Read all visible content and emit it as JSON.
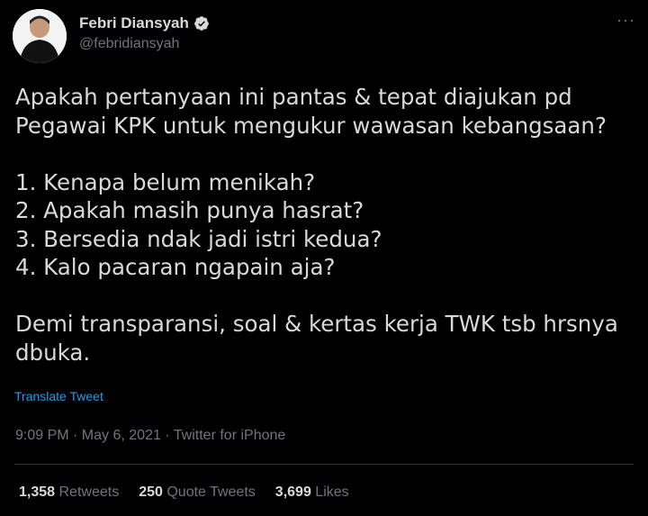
{
  "author": {
    "name": "Febri Diansyah",
    "handle": "@febridiansyah",
    "avatar_icon": "avatar-icon",
    "verified_icon": "verified-badge-icon",
    "verified_color": "#d9d9d9"
  },
  "more_label": "···",
  "tweet": {
    "text": "Apakah pertanyaan ini pantas & tepat diajukan pd\nPegawai KPK untuk mengukur wawasan kebangsaan?\n\n1. Kenapa belum menikah?\n2. Apakah masih punya hasrat?\n3. Bersedia ndak jadi istri kedua?\n4. Kalo pacaran ngapain aja?\n\nDemi transparansi, soal & kertas kerja TWK tsb hrsnya\ndbuka.",
    "translate_label": "Translate Tweet",
    "timestamp": "9:09 PM · May 6, 2021 · Twitter for iPhone"
  },
  "stats": {
    "retweets_count": "1,358",
    "retweets_label": "Retweets",
    "quotes_count": "250",
    "quotes_label": "Quote Tweets",
    "likes_count": "3,699",
    "likes_label": "Likes"
  },
  "colors": {
    "background": "#000000",
    "text": "#d9d9d9",
    "muted": "#6e767d",
    "link": "#1d9bf0",
    "divider": "#2f3336"
  }
}
